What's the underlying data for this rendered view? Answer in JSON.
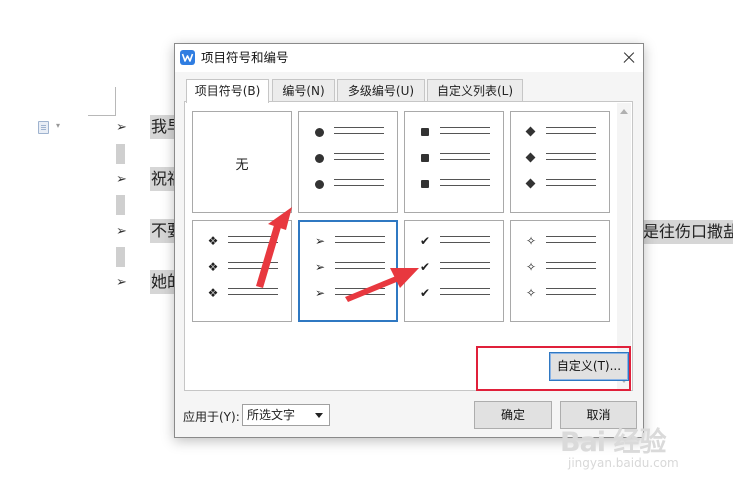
{
  "document": {
    "bullet_symbol": "➢",
    "lines": [
      "我早",
      "祝福",
      "不要",
      "她的"
    ],
    "right_fragment": "是往伤口撒盐",
    "caret_symbol": "▾"
  },
  "dialog": {
    "title": "项目符号和编号",
    "tabs": [
      "项目符号(B)",
      "编号(N)",
      "多级编号(U)",
      "自定义列表(L)"
    ],
    "active_tab": "项目符号(B)",
    "gallery": {
      "none_label": "无",
      "styles": [
        {
          "id": "none",
          "symbol": ""
        },
        {
          "id": "filled-circle",
          "symbol": "●"
        },
        {
          "id": "filled-square",
          "symbol": "■"
        },
        {
          "id": "filled-diamond",
          "symbol": "◆"
        },
        {
          "id": "four-diamond",
          "symbol": "❖"
        },
        {
          "id": "arrowhead",
          "symbol": "➢"
        },
        {
          "id": "checkmark",
          "symbol": "✔"
        },
        {
          "id": "star",
          "symbol": "✧"
        }
      ],
      "selected": "arrowhead"
    },
    "customize_button": "自定义(T)...",
    "apply_to_label": "应用于(Y):",
    "apply_to_value": "所选文字",
    "ok_button": "确定",
    "cancel_button": "取消"
  },
  "annotations": {
    "highlight_color": "#e0203a",
    "arrow_color": "#e8383f"
  },
  "watermark": {
    "logo": "Bai 经验",
    "url": "jingyan.baidu.com"
  }
}
